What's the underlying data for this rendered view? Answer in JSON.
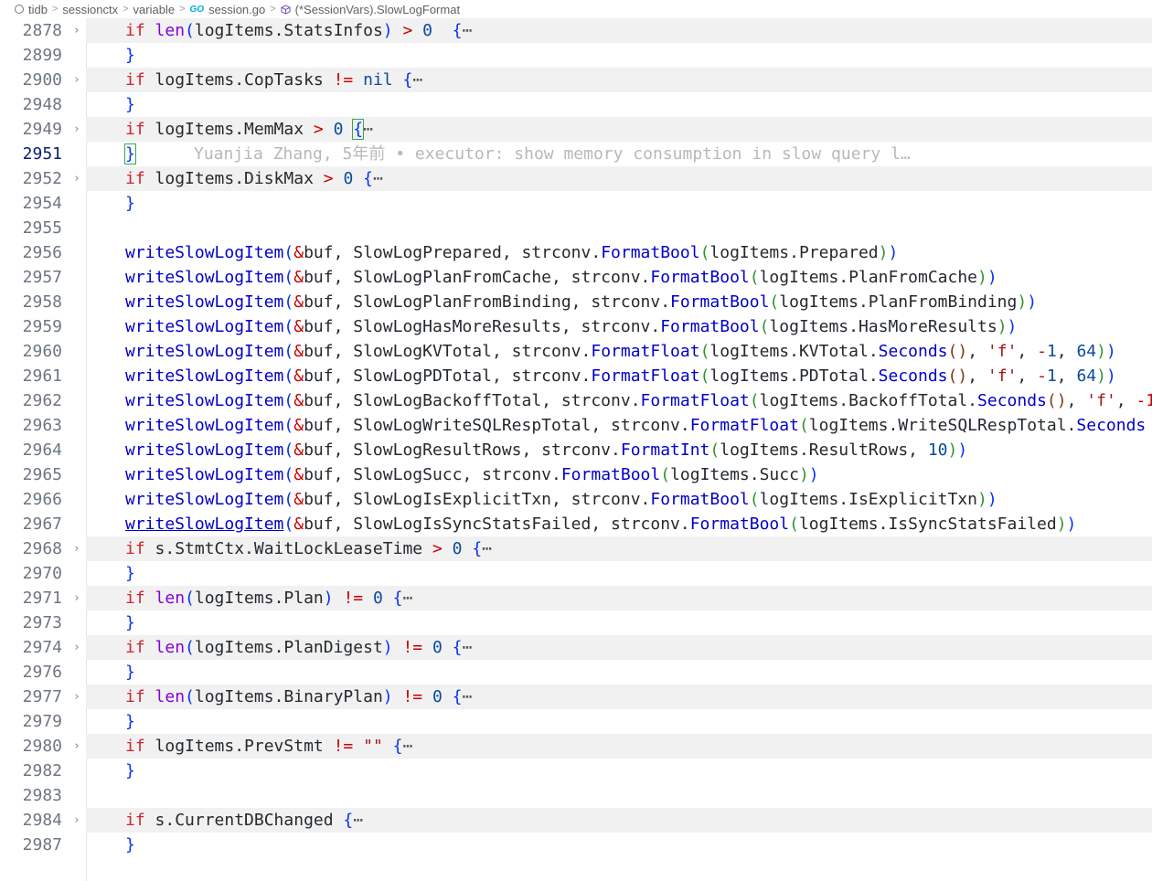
{
  "breadcrumb": {
    "items": [
      {
        "label": "tidb",
        "icon": "repo-icon"
      },
      {
        "label": "sessionctx",
        "icon": ""
      },
      {
        "label": "variable",
        "icon": ""
      },
      {
        "label": "session.go",
        "icon": "go-file-icon"
      },
      {
        "label": "(*SessionVars).SlowLogFormat",
        "icon": "method-icon"
      }
    ]
  },
  "blame": "Yuanjia Zhang, 5年前 • executor: show memory consumption in slow query l…",
  "lines": [
    {
      "num": "2878",
      "fold": true,
      "current": false,
      "tokens": [
        [
          "kw",
          "if "
        ],
        [
          "bi",
          "len"
        ],
        [
          "brk1",
          "("
        ],
        [
          "",
          "logItems.StatsInfos"
        ],
        [
          "brk1",
          ")"
        ],
        [
          "op",
          " > "
        ],
        [
          "num",
          "0"
        ],
        [
          "",
          "  "
        ],
        [
          "brk1",
          "{"
        ],
        [
          "ell",
          "⋯"
        ]
      ]
    },
    {
      "num": "2899",
      "fold": false,
      "current": false,
      "tokens": [
        [
          "brk1",
          "}"
        ]
      ]
    },
    {
      "num": "2900",
      "fold": true,
      "current": false,
      "tokens": [
        [
          "kw",
          "if "
        ],
        [
          "",
          "logItems.CopTasks "
        ],
        [
          "op",
          "!= "
        ],
        [
          "num",
          "nil"
        ],
        [
          "",
          ""
        ],
        [
          "brk1",
          " {"
        ],
        [
          "ell",
          "⋯"
        ]
      ]
    },
    {
      "num": "2948",
      "fold": false,
      "current": false,
      "tokens": [
        [
          "brk1",
          "}"
        ]
      ]
    },
    {
      "num": "2949",
      "fold": true,
      "current": false,
      "tokens": [
        [
          "kw",
          "if "
        ],
        [
          "",
          "logItems.MemMax "
        ],
        [
          "op",
          "> "
        ],
        [
          "num",
          "0 "
        ],
        [
          "brk1",
          "{"
        ],
        [
          "ell",
          "⋯"
        ]
      ]
    },
    {
      "num": "2951",
      "fold": false,
      "current": true,
      "tokens": [
        [
          "brk1",
          "}"
        ]
      ],
      "blame": true
    },
    {
      "num": "2952",
      "fold": true,
      "current": false,
      "tokens": [
        [
          "kw",
          "if "
        ],
        [
          "",
          "logItems.DiskMax "
        ],
        [
          "op",
          "> "
        ],
        [
          "num",
          "0 "
        ],
        [
          "brk1",
          "{"
        ],
        [
          "ell",
          "⋯"
        ]
      ]
    },
    {
      "num": "2954",
      "fold": false,
      "current": false,
      "tokens": [
        [
          "brk1",
          "}"
        ]
      ]
    },
    {
      "num": "2955",
      "fold": false,
      "current": false,
      "tokens": []
    },
    {
      "num": "2956",
      "fold": false,
      "current": false,
      "tokens": [
        [
          "fn",
          "writeSlowLogItem"
        ],
        [
          "brk1",
          "("
        ],
        [
          "op",
          "&"
        ],
        [
          "",
          "buf, SlowLogPrepared, strconv."
        ],
        [
          "fn",
          "FormatBool"
        ],
        [
          "brk2",
          "("
        ],
        [
          "",
          "logItems.Prepared"
        ],
        [
          "brk2",
          ")"
        ],
        [
          "brk1",
          ")"
        ]
      ]
    },
    {
      "num": "2957",
      "fold": false,
      "current": false,
      "tokens": [
        [
          "fn",
          "writeSlowLogItem"
        ],
        [
          "brk1",
          "("
        ],
        [
          "op",
          "&"
        ],
        [
          "",
          "buf, SlowLogPlanFromCache, strconv."
        ],
        [
          "fn",
          "FormatBool"
        ],
        [
          "brk2",
          "("
        ],
        [
          "",
          "logItems.PlanFromCache"
        ],
        [
          "brk2",
          ")"
        ],
        [
          "brk1",
          ")"
        ]
      ]
    },
    {
      "num": "2958",
      "fold": false,
      "current": false,
      "tokens": [
        [
          "fn",
          "writeSlowLogItem"
        ],
        [
          "brk1",
          "("
        ],
        [
          "op",
          "&"
        ],
        [
          "",
          "buf, SlowLogPlanFromBinding, strconv."
        ],
        [
          "fn",
          "FormatBool"
        ],
        [
          "brk2",
          "("
        ],
        [
          "",
          "logItems.PlanFromBinding"
        ],
        [
          "brk2",
          ")"
        ],
        [
          "brk1",
          ")"
        ]
      ]
    },
    {
      "num": "2959",
      "fold": false,
      "current": false,
      "tokens": [
        [
          "fn",
          "writeSlowLogItem"
        ],
        [
          "brk1",
          "("
        ],
        [
          "op",
          "&"
        ],
        [
          "",
          "buf, SlowLogHasMoreResults, strconv."
        ],
        [
          "fn",
          "FormatBool"
        ],
        [
          "brk2",
          "("
        ],
        [
          "",
          "logItems.HasMoreResults"
        ],
        [
          "brk2",
          ")"
        ],
        [
          "brk1",
          ")"
        ]
      ]
    },
    {
      "num": "2960",
      "fold": false,
      "current": false,
      "tokens": [
        [
          "fn",
          "writeSlowLogItem"
        ],
        [
          "brk1",
          "("
        ],
        [
          "op",
          "&"
        ],
        [
          "",
          "buf, SlowLogKVTotal, strconv."
        ],
        [
          "fn",
          "FormatFloat"
        ],
        [
          "brk2",
          "("
        ],
        [
          "",
          "logItems.KVTotal."
        ],
        [
          "fn",
          "Seconds"
        ],
        [
          "brk3",
          "()"
        ],
        [
          "",
          ", "
        ],
        [
          "str",
          "'f'"
        ],
        [
          "",
          ", "
        ],
        [
          "op",
          "-"
        ],
        [
          "num",
          "1"
        ],
        [
          "",
          ", "
        ],
        [
          "num",
          "64"
        ],
        [
          "brk2",
          ")"
        ],
        [
          "brk1",
          ")"
        ]
      ]
    },
    {
      "num": "2961",
      "fold": false,
      "current": false,
      "tokens": [
        [
          "fn",
          "writeSlowLogItem"
        ],
        [
          "brk1",
          "("
        ],
        [
          "op",
          "&"
        ],
        [
          "",
          "buf, SlowLogPDTotal, strconv."
        ],
        [
          "fn",
          "FormatFloat"
        ],
        [
          "brk2",
          "("
        ],
        [
          "",
          "logItems.PDTotal."
        ],
        [
          "fn",
          "Seconds"
        ],
        [
          "brk3",
          "()"
        ],
        [
          "",
          ", "
        ],
        [
          "str",
          "'f'"
        ],
        [
          "",
          ", "
        ],
        [
          "op",
          "-"
        ],
        [
          "num",
          "1"
        ],
        [
          "",
          ", "
        ],
        [
          "num",
          "64"
        ],
        [
          "brk2",
          ")"
        ],
        [
          "brk1",
          ")"
        ]
      ]
    },
    {
      "num": "2962",
      "fold": false,
      "current": false,
      "tokens": [
        [
          "fn",
          "writeSlowLogItem"
        ],
        [
          "brk1",
          "("
        ],
        [
          "op",
          "&"
        ],
        [
          "",
          "buf, SlowLogBackoffTotal, strconv."
        ],
        [
          "fn",
          "FormatFloat"
        ],
        [
          "brk2",
          "("
        ],
        [
          "",
          "logItems.BackoffTotal."
        ],
        [
          "fn",
          "Seconds"
        ],
        [
          "brk3",
          "()"
        ],
        [
          "",
          ", "
        ],
        [
          "str",
          "'f'"
        ],
        [
          "",
          ", "
        ],
        [
          "op",
          "-1"
        ]
      ]
    },
    {
      "num": "2963",
      "fold": false,
      "current": false,
      "tokens": [
        [
          "fn",
          "writeSlowLogItem"
        ],
        [
          "brk1",
          "("
        ],
        [
          "op",
          "&"
        ],
        [
          "",
          "buf, SlowLogWriteSQLRespTotal, strconv."
        ],
        [
          "fn",
          "FormatFloat"
        ],
        [
          "brk2",
          "("
        ],
        [
          "",
          "logItems.WriteSQLRespTotal."
        ],
        [
          "fn",
          "Seconds"
        ]
      ]
    },
    {
      "num": "2964",
      "fold": false,
      "current": false,
      "tokens": [
        [
          "fn",
          "writeSlowLogItem"
        ],
        [
          "brk1",
          "("
        ],
        [
          "op",
          "&"
        ],
        [
          "",
          "buf, SlowLogResultRows, strconv."
        ],
        [
          "fn",
          "FormatInt"
        ],
        [
          "brk2",
          "("
        ],
        [
          "",
          "logItems.ResultRows, "
        ],
        [
          "num",
          "10"
        ],
        [
          "brk2",
          ")"
        ],
        [
          "brk1",
          ")"
        ]
      ]
    },
    {
      "num": "2965",
      "fold": false,
      "current": false,
      "tokens": [
        [
          "fn",
          "writeSlowLogItem"
        ],
        [
          "brk1",
          "("
        ],
        [
          "op",
          "&"
        ],
        [
          "",
          "buf, SlowLogSucc, strconv."
        ],
        [
          "fn",
          "FormatBool"
        ],
        [
          "brk2",
          "("
        ],
        [
          "",
          "logItems.Succ"
        ],
        [
          "brk2",
          ")"
        ],
        [
          "brk1",
          ")"
        ]
      ]
    },
    {
      "num": "2966",
      "fold": false,
      "current": false,
      "tokens": [
        [
          "fn",
          "writeSlowLogItem"
        ],
        [
          "brk1",
          "("
        ],
        [
          "op",
          "&"
        ],
        [
          "",
          "buf, SlowLogIsExplicitTxn, strconv."
        ],
        [
          "fn",
          "FormatBool"
        ],
        [
          "brk2",
          "("
        ],
        [
          "",
          "logItems.IsExplicitTxn"
        ],
        [
          "brk2",
          ")"
        ],
        [
          "brk1",
          ")"
        ]
      ]
    },
    {
      "num": "2967",
      "fold": false,
      "current": false,
      "tokens": [
        [
          "fnu",
          "writeSlowLogItem"
        ],
        [
          "brk1",
          "("
        ],
        [
          "op",
          "&"
        ],
        [
          "",
          "buf, SlowLogIsSyncStatsFailed, strconv."
        ],
        [
          "fn",
          "FormatBool"
        ],
        [
          "brk2",
          "("
        ],
        [
          "",
          "logItems.IsSyncStatsFailed"
        ],
        [
          "brk2",
          ")"
        ],
        [
          "brk1",
          ")"
        ]
      ]
    },
    {
      "num": "2968",
      "fold": true,
      "current": false,
      "tokens": [
        [
          "kw",
          "if "
        ],
        [
          "",
          "s.StmtCtx.WaitLockLeaseTime "
        ],
        [
          "op",
          "> "
        ],
        [
          "num",
          "0 "
        ],
        [
          "brk1",
          "{"
        ],
        [
          "ell",
          "⋯"
        ]
      ]
    },
    {
      "num": "2970",
      "fold": false,
      "current": false,
      "tokens": [
        [
          "brk1",
          "}"
        ]
      ]
    },
    {
      "num": "2971",
      "fold": true,
      "current": false,
      "tokens": [
        [
          "kw",
          "if "
        ],
        [
          "bi",
          "len"
        ],
        [
          "brk1",
          "("
        ],
        [
          "",
          "logItems.Plan"
        ],
        [
          "brk1",
          ")"
        ],
        [
          "op",
          " != "
        ],
        [
          "num",
          "0 "
        ],
        [
          "brk1",
          "{"
        ],
        [
          "ell",
          "⋯"
        ]
      ]
    },
    {
      "num": "2973",
      "fold": false,
      "current": false,
      "tokens": [
        [
          "brk1",
          "}"
        ]
      ]
    },
    {
      "num": "2974",
      "fold": true,
      "current": false,
      "tokens": [
        [
          "kw",
          "if "
        ],
        [
          "bi",
          "len"
        ],
        [
          "brk1",
          "("
        ],
        [
          "",
          "logItems.PlanDigest"
        ],
        [
          "brk1",
          ")"
        ],
        [
          "op",
          " != "
        ],
        [
          "num",
          "0 "
        ],
        [
          "brk1",
          "{"
        ],
        [
          "ell",
          "⋯"
        ]
      ]
    },
    {
      "num": "2976",
      "fold": false,
      "current": false,
      "tokens": [
        [
          "brk1",
          "}"
        ]
      ]
    },
    {
      "num": "2977",
      "fold": true,
      "current": false,
      "tokens": [
        [
          "kw",
          "if "
        ],
        [
          "bi",
          "len"
        ],
        [
          "brk1",
          "("
        ],
        [
          "",
          "logItems.BinaryPlan"
        ],
        [
          "brk1",
          ")"
        ],
        [
          "op",
          " != "
        ],
        [
          "num",
          "0 "
        ],
        [
          "brk1",
          "{"
        ],
        [
          "ell",
          "⋯"
        ]
      ]
    },
    {
      "num": "2979",
      "fold": false,
      "current": false,
      "tokens": [
        [
          "brk1",
          "}"
        ]
      ]
    },
    {
      "num": "2980",
      "fold": true,
      "current": false,
      "tokens": [
        [
          "kw",
          "if "
        ],
        [
          "",
          "logItems.PrevStmt "
        ],
        [
          "op",
          "!= "
        ],
        [
          "str",
          "\"\""
        ],
        [
          "brk1",
          " {"
        ],
        [
          "ell",
          "⋯"
        ]
      ]
    },
    {
      "num": "2982",
      "fold": false,
      "current": false,
      "tokens": [
        [
          "brk1",
          "}"
        ]
      ]
    },
    {
      "num": "2983",
      "fold": false,
      "current": false,
      "tokens": []
    },
    {
      "num": "2984",
      "fold": true,
      "current": false,
      "tokens": [
        [
          "kw",
          "if "
        ],
        [
          "",
          "s.CurrentDBChanged "
        ],
        [
          "brk1",
          "{"
        ],
        [
          "ell",
          "⋯"
        ]
      ]
    },
    {
      "num": "2987",
      "fold": false,
      "current": false,
      "tokens": [
        [
          "brk1",
          "}"
        ]
      ]
    }
  ]
}
